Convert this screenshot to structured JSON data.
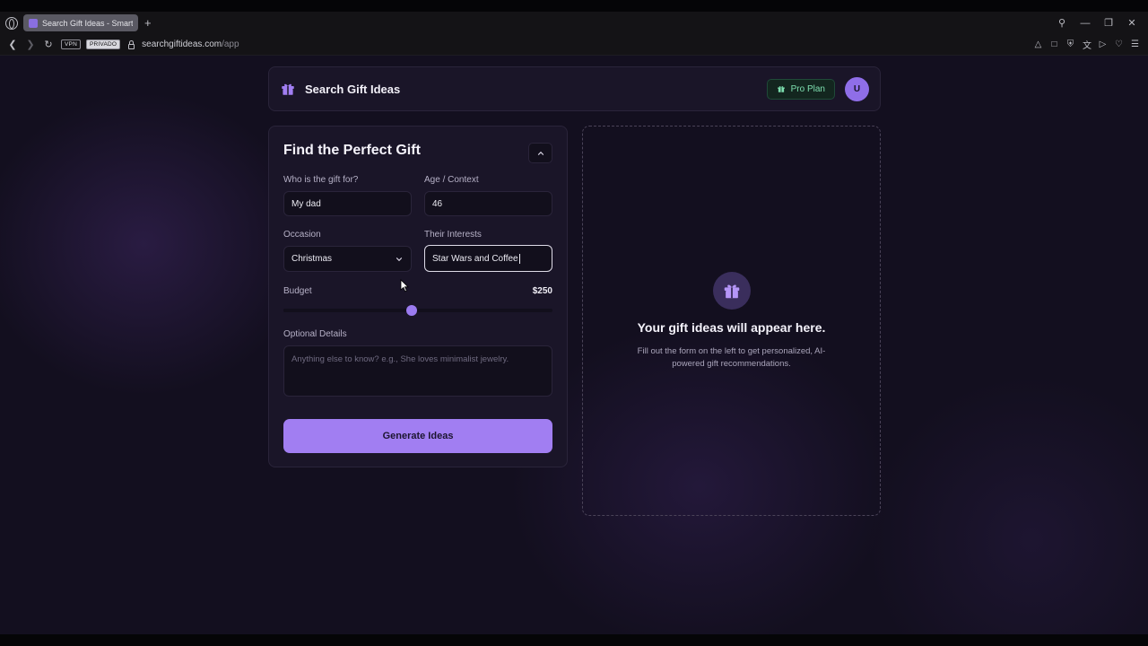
{
  "browser": {
    "tab_title": "Search Gift Ideas - Smart",
    "new_tab_icon": "+",
    "vpn_label": "VPN",
    "private_label": "PRIVADO",
    "url_domain": "searchgiftideas.com",
    "url_path": "/app"
  },
  "header": {
    "app_name": "Search Gift Ideas",
    "plan_label": "Pro Plan",
    "avatar_initial": "U"
  },
  "form": {
    "title": "Find the Perfect Gift",
    "recipient_label": "Who is the gift for?",
    "recipient_value": "My dad",
    "age_label": "Age / Context",
    "age_value": "46",
    "occasion_label": "Occasion",
    "occasion_value": "Christmas",
    "interests_label": "Their Interests",
    "interests_value": "Star Wars and Coffee",
    "budget_label": "Budget",
    "budget_value": "$250",
    "budget_slider_fraction": 0.475,
    "details_label": "Optional Details",
    "details_placeholder": "Anything else to know? e.g., She loves minimalist jewelry.",
    "generate_label": "Generate Ideas"
  },
  "results": {
    "title": "Your gift ideas will appear here.",
    "description": "Fill out the form on the left to get personalized, AI-powered gift recommendations."
  },
  "colors": {
    "accent": "#a17ef2",
    "background": "#130f1f",
    "card": "#1a1528",
    "pro_badge_text": "#7ee0b0"
  },
  "icons": {
    "brand": "gift-icon",
    "pro_badge": "gift-icon",
    "results": "gift-icon",
    "collapse": "chevron-up-icon",
    "occasion_select": "chevron-down-icon"
  }
}
